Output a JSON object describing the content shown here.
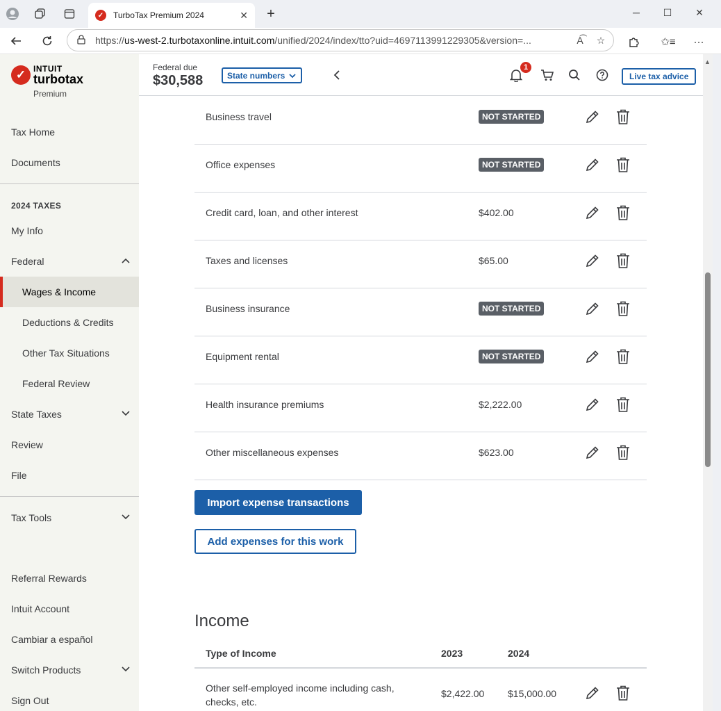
{
  "browser": {
    "tab_title": "TurboTax Premium 2024",
    "url_prefix": "https://",
    "url_host": "us-west-2.turbotaxonline.intuit.com",
    "url_path": "/unified/2024/index/tto?uid=4697113991229305&version=..."
  },
  "brand": {
    "intuit": "INTUIT",
    "product": "turbotax",
    "tier": "Premium",
    "accent": "#d52b1e",
    "primary": "#1c5fa8"
  },
  "sidebar": {
    "top_items": [
      "Tax Home",
      "Documents"
    ],
    "section_label": "2024 TAXES",
    "items": {
      "my_info": "My Info",
      "federal": "Federal",
      "wages": "Wages & Income",
      "deductions": "Deductions & Credits",
      "other": "Other Tax Situations",
      "fed_review": "Federal Review",
      "state": "State Taxes",
      "review": "Review",
      "file": "File",
      "tools": "Tax Tools",
      "referral": "Referral Rewards",
      "account": "Intuit Account",
      "spanish": "Cambiar a español",
      "switch": "Switch Products",
      "signout": "Sign Out"
    }
  },
  "header": {
    "federal_label": "Federal due",
    "federal_amount": "$30,588",
    "state_button": "State numbers",
    "notification_count": "1",
    "live_button": "Live tax advice"
  },
  "expenses": [
    {
      "label": "Business travel",
      "status": "NOT STARTED",
      "value": ""
    },
    {
      "label": "Office expenses",
      "status": "NOT STARTED",
      "value": ""
    },
    {
      "label": "Credit card, loan, and other interest",
      "status": "",
      "value": "$402.00"
    },
    {
      "label": "Taxes and licenses",
      "status": "",
      "value": "$65.00"
    },
    {
      "label": "Business insurance",
      "status": "NOT STARTED",
      "value": ""
    },
    {
      "label": "Equipment rental",
      "status": "NOT STARTED",
      "value": ""
    },
    {
      "label": "Health insurance premiums",
      "status": "",
      "value": "$2,222.00"
    },
    {
      "label": "Other miscellaneous expenses",
      "status": "",
      "value": "$623.00"
    }
  ],
  "buttons": {
    "import": "Import expense transactions",
    "add": "Add expenses for this work"
  },
  "income": {
    "title": "Income",
    "columns": [
      "Type of Income",
      "2023",
      "2024"
    ],
    "rows": [
      {
        "type": "Other self-employed income including cash, checks, etc.",
        "y2023": "$2,422.00",
        "y2024": "$15,000.00"
      }
    ]
  }
}
